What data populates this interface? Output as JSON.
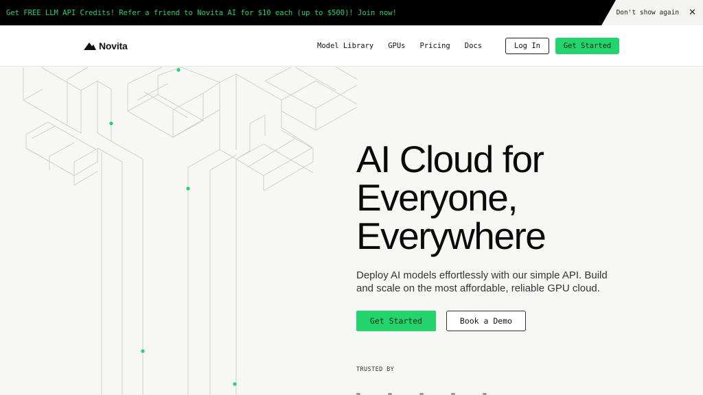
{
  "promo": {
    "text": "Get FREE LLM API Credits! Refer a friend to Novita AI for $10 each (up to $500)! Join now!",
    "dismiss_label": "Don't show again",
    "close_glyph": "✕",
    "accent_color": "#23d36b"
  },
  "nav": {
    "logo_text": "Novita",
    "links": [
      "Model Library",
      "GPUs",
      "Pricing",
      "Docs"
    ],
    "login_label": "Log In",
    "cta_label": "Get Started"
  },
  "hero": {
    "title_lines": [
      "AI Cloud for",
      "Everyone,",
      "Everywhere"
    ],
    "subtitle": "Deploy AI models effortlessly with our simple API. Build and scale on the most affordable, reliable GPU cloud.",
    "primary_label": "Get Started",
    "secondary_label": "Book a Demo",
    "trusted_label": "TRUSTED BY"
  },
  "colors": {
    "brand_green": "#23d36b",
    "line_gray": "#c8c8c8"
  },
  "icons": {
    "logo": "novita-triangle-icon",
    "close": "close-icon"
  }
}
